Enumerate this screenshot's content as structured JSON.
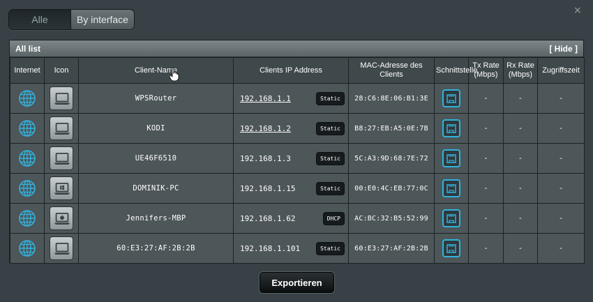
{
  "close_label": "×",
  "tabs": [
    {
      "label": "Alle",
      "active": false
    },
    {
      "label": "By interface",
      "active": true
    }
  ],
  "panel": {
    "title": "All list",
    "hide_label": "[ Hide ]"
  },
  "columns": {
    "internet": "Internet",
    "icon": "Icon",
    "client_name": "Client-Name",
    "ip": "Clients IP Address",
    "mac": "MAC-Adresse des Clients",
    "interface": "Schnittstelle",
    "tx": "Tx Rate (Mbps)",
    "rx": "Rx Rate (Mbps)",
    "access_time": "Zugriffszeit"
  },
  "clients": [
    {
      "name": "WPSRouter",
      "ip": "192.168.1.1",
      "ip_link": true,
      "ip_type": "Static",
      "mac": "28:C6:8E:06:B1:3E",
      "device_icon": "laptop-icon",
      "tx": "-",
      "rx": "-",
      "access_time": "-"
    },
    {
      "name": "KODI",
      "ip": "192.168.1.2",
      "ip_link": true,
      "ip_type": "Static",
      "mac": "B8:27:EB:A5:0E:7B",
      "device_icon": "laptop-icon",
      "tx": "-",
      "rx": "-",
      "access_time": "-"
    },
    {
      "name": "UE46F6510",
      "ip": "192.168.1.3",
      "ip_link": false,
      "ip_type": "Static",
      "mac": "5C:A3:9D:68:7E:72",
      "device_icon": "laptop-icon",
      "tx": "-",
      "rx": "-",
      "access_time": "-"
    },
    {
      "name": "DOMINIK-PC",
      "ip": "192.168.1.15",
      "ip_link": false,
      "ip_type": "Static",
      "mac": "00:E0:4C:EB:77:0C",
      "device_icon": "windows-laptop-icon",
      "tx": "-",
      "rx": "-",
      "access_time": "-"
    },
    {
      "name": "Jennifers-MBP",
      "ip": "192.168.1.62",
      "ip_link": false,
      "ip_type": "DHCP",
      "mac": "AC:BC:32:B5:52:99",
      "device_icon": "apple-laptop-icon",
      "tx": "-",
      "rx": "-",
      "access_time": "-"
    },
    {
      "name": "60:E3:27:AF:2B:2B",
      "ip": "192.168.1.101",
      "ip_link": false,
      "ip_type": "Static",
      "mac": "60:E3:27:AF:2B:2B",
      "device_icon": "laptop-icon",
      "tx": "-",
      "rx": "-",
      "access_time": "-"
    }
  ],
  "export_label": "Exportieren",
  "colors": {
    "accent": "#2fb3e0",
    "background": "#384145",
    "panel": "#4d5659"
  }
}
